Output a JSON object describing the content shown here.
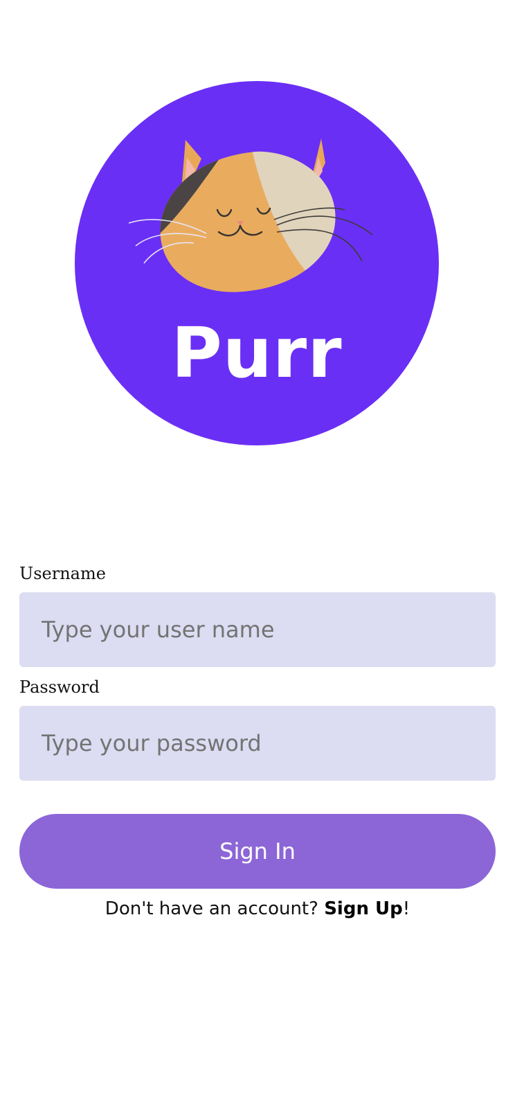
{
  "logo": {
    "text": "Purr",
    "circle_color": "#6a2ff5",
    "icon": "cat-face-icon"
  },
  "form": {
    "username_label": "Username",
    "username_placeholder": "Type your user name",
    "username_value": "",
    "password_label": "Password",
    "password_placeholder": "Type your password",
    "password_value": "",
    "signin_label": "Sign In"
  },
  "signup": {
    "prompt": "Don't have an account? ",
    "link_label": "Sign Up",
    "suffix": "!"
  },
  "colors": {
    "input_background": "#dcdcf2",
    "button_background": "#8c66d6"
  }
}
